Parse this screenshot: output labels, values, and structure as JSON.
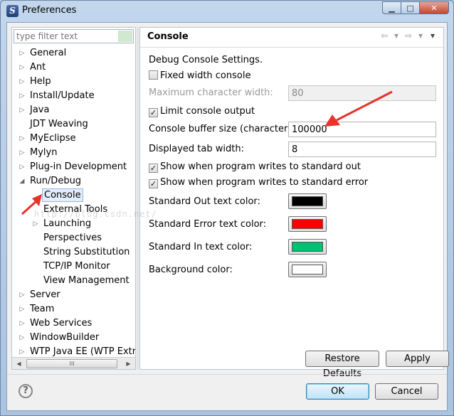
{
  "window": {
    "title": "Preferences"
  },
  "filter": {
    "placeholder": "type filter text"
  },
  "tree": {
    "items": [
      {
        "label": "General",
        "expandable": true
      },
      {
        "label": "Ant",
        "expandable": true
      },
      {
        "label": "Help",
        "expandable": true
      },
      {
        "label": "Install/Update",
        "expandable": true
      },
      {
        "label": "Java",
        "expandable": true
      },
      {
        "label": "JDT Weaving",
        "expandable": false
      },
      {
        "label": "MyEclipse",
        "expandable": true
      },
      {
        "label": "Mylyn",
        "expandable": true
      },
      {
        "label": "Plug-in Development",
        "expandable": true
      },
      {
        "label": "Run/Debug",
        "expandable": true,
        "expanded": true
      },
      {
        "label": "Console",
        "selected": true
      },
      {
        "label": "External Tools"
      },
      {
        "label": "Launching",
        "expandable": true
      },
      {
        "label": "Perspectives"
      },
      {
        "label": "String Substitution"
      },
      {
        "label": "TCP/IP Monitor"
      },
      {
        "label": "View Management"
      },
      {
        "label": "Server",
        "expandable": true
      },
      {
        "label": "Team",
        "expandable": true
      },
      {
        "label": "Web Services",
        "expandable": true
      },
      {
        "label": "WindowBuilder",
        "expandable": true
      },
      {
        "label": "WTP Java EE (WTP Extras",
        "expandable": true
      }
    ],
    "scroll_thumb": "III"
  },
  "page": {
    "title": "Console",
    "description": "Debug Console Settings.",
    "fixed_width": {
      "label": "Fixed width console",
      "checked": false
    },
    "max_width": {
      "label": "Maximum character width:",
      "value": "80"
    },
    "limit_output": {
      "label": "Limit console output",
      "checked": true
    },
    "buffer_size": {
      "label": "Console buffer size (characters):",
      "value": "100000"
    },
    "tab_width": {
      "label": "Displayed tab width:",
      "value": "8"
    },
    "show_out": {
      "label": "Show when program writes to standard out",
      "checked": true
    },
    "show_err": {
      "label": "Show when program writes to standard error",
      "checked": true
    },
    "colors": [
      {
        "label": "Standard Out text color:",
        "color": "#000000"
      },
      {
        "label": "Standard Error text color:",
        "color": "#ff0000"
      },
      {
        "label": "Standard In text color:",
        "color": "#00c073"
      },
      {
        "label": "Background color:",
        "color": "#ffffff"
      }
    ],
    "restore_defaults": "Restore Defaults",
    "apply": "Apply"
  },
  "buttons": {
    "ok": "OK",
    "cancel": "Cancel",
    "help": "?"
  },
  "watermark": "http://blog.csdn.net/",
  "accent_colors": {
    "annotation_arrow": "#e8322b",
    "selection": "#e4eefb"
  }
}
